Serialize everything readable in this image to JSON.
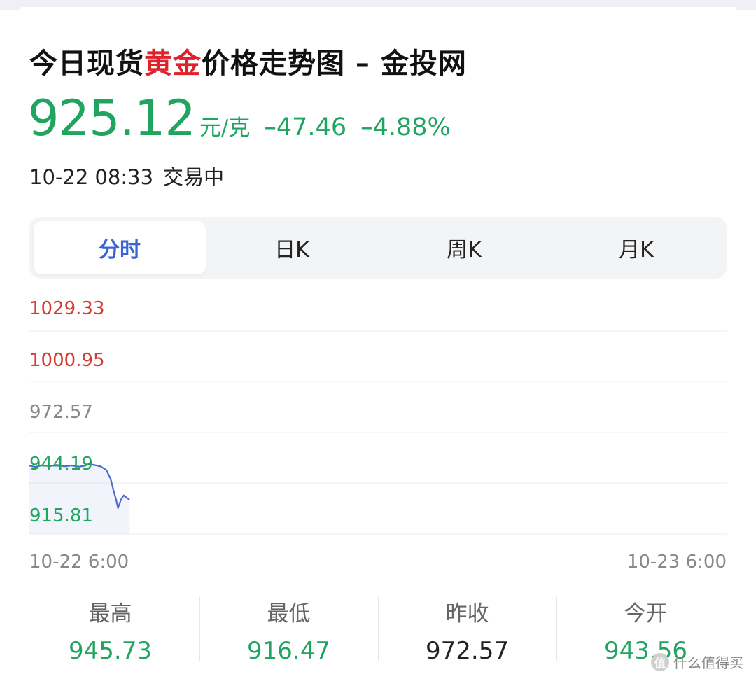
{
  "header": {
    "title_prefix": "今日现货",
    "title_highlight": "黄金",
    "title_suffix": "价格走势图 – 金投网"
  },
  "quote": {
    "price": "925.12",
    "unit": "元/克",
    "change": "–47.46",
    "change_pct": "–4.88%",
    "color_down": "#1fa560"
  },
  "status": {
    "datetime": "10-22 08:33",
    "state": "交易中"
  },
  "tabs": [
    {
      "label": "分时",
      "active": true
    },
    {
      "label": "日K",
      "active": false
    },
    {
      "label": "周K",
      "active": false
    },
    {
      "label": "月K",
      "active": false
    }
  ],
  "chart_data": {
    "type": "line",
    "y_ticks": [
      "1029.33",
      "1000.95",
      "972.57",
      "944.19",
      "915.81"
    ],
    "ylim": [
      915.81,
      1029.33
    ],
    "x_range_labels": [
      "10-22 6:00",
      "10-23 6:00"
    ],
    "x_range_hours": [
      0,
      24
    ],
    "series": [
      {
        "color": "#4a6ad0",
        "points": [
          [
            0.0,
            943.9
          ],
          [
            0.2,
            943.2
          ],
          [
            0.45,
            944.1
          ],
          [
            0.7,
            943.6
          ],
          [
            0.95,
            944.3
          ],
          [
            1.2,
            943.5
          ],
          [
            1.45,
            944.0
          ],
          [
            1.7,
            943.3
          ],
          [
            1.9,
            943.8
          ],
          [
            2.05,
            944.8
          ],
          [
            2.25,
            944.2
          ],
          [
            2.45,
            943.5
          ],
          [
            2.65,
            941.5
          ],
          [
            2.8,
            936.5
          ],
          [
            2.9,
            930.0
          ],
          [
            2.98,
            925.5
          ],
          [
            3.05,
            920.5
          ],
          [
            3.15,
            925.0
          ],
          [
            3.25,
            927.5
          ],
          [
            3.35,
            926.2
          ],
          [
            3.45,
            925.12
          ]
        ]
      }
    ],
    "grid": true,
    "colors": {
      "above_prev": "#d33a32",
      "prev_close": "#888888",
      "below_prev": "#1fa560"
    }
  },
  "stats": [
    {
      "label": "最高",
      "value": "945.73",
      "tone": "green"
    },
    {
      "label": "最低",
      "value": "916.47",
      "tone": "green"
    },
    {
      "label": "昨收",
      "value": "972.57",
      "tone": "dark"
    },
    {
      "label": "今开",
      "value": "943.56",
      "tone": "green"
    }
  ],
  "watermark": {
    "icon": "值",
    "text": "什么值得买"
  }
}
